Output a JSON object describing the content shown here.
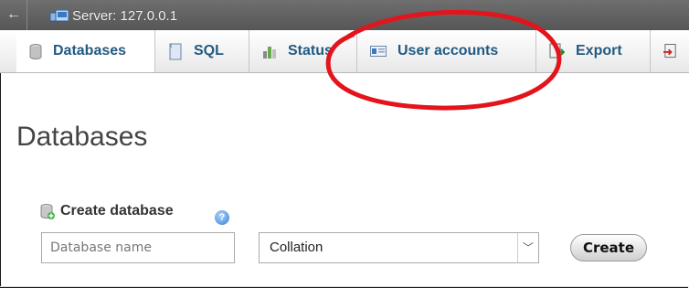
{
  "window": {
    "back_glyph": "←",
    "server_label": "Server: 127.0.0.1"
  },
  "tabs": [
    {
      "label": "Databases",
      "icon": "database-icon",
      "active": true
    },
    {
      "label": "SQL",
      "icon": "sql-icon",
      "active": false
    },
    {
      "label": "Status",
      "icon": "status-icon",
      "active": false
    },
    {
      "label": "User accounts",
      "icon": "user-accounts-icon",
      "active": false
    },
    {
      "label": "Export",
      "icon": "export-icon",
      "active": false
    }
  ],
  "page": {
    "title": "Databases"
  },
  "create_db": {
    "heading": "Create database",
    "help_glyph": "?",
    "name_placeholder": "Database name",
    "collation_value": "Collation",
    "create_label": "Create"
  },
  "colors": {
    "accent_tab_text": "#235a81",
    "annotation_red": "#e3141b",
    "titlebar": "#5e5e5e"
  }
}
